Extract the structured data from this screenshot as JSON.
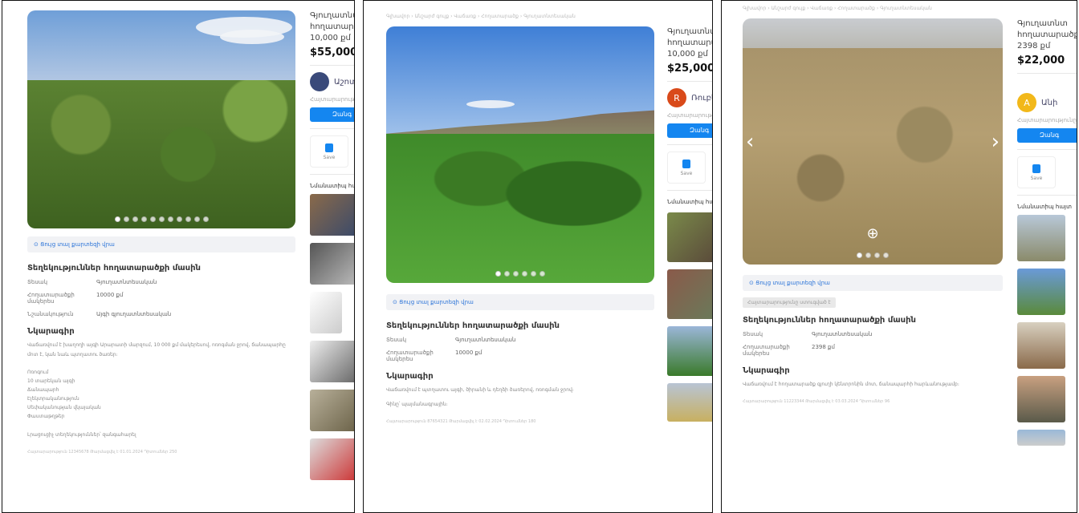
{
  "panels": [
    {
      "side": {
        "title_line1": "Գյուղատնտ",
        "title_line2": "հողատարածք",
        "title_line3": "10,000 քմ",
        "price": "$55,000",
        "seller_name": "Աշոտ",
        "posted": "Հայտարարությունը",
        "cta_label": "Զանգ",
        "save_label": "Save",
        "similar_heading": "Նմանատիպ հայտ"
      },
      "content": {
        "map_link": "Ցույց տալ քարտեզի վրա",
        "info_heading": "Տեղեկություններ հողատարածքի մասին",
        "rows": [
          {
            "k": "Տեսակ",
            "v": "Գյուղատնտեսական"
          },
          {
            "k": "Հողատարածքի մակերես",
            "v": "10000 քմ"
          },
          {
            "k": "Նշանակություն",
            "v": "Այգի գյուղատնտեսական"
          }
        ],
        "desc_heading": "Նկարագիր",
        "desc": "Վաճառվում է խաղողի այգի Արարատի մարզում, 10 000 քմ մակերեսով, ոռոգման ջրով, ճանապարհը մոտ է, կան նաև պտղատու ծառեր։",
        "list": [
          "Ոռոգում",
          "10 տարեկան այգի",
          "Ճանապարհ",
          "Էլեկտրականություն",
          "Սեփականության վկայական",
          "Փաստաթղթեր"
        ],
        "extra": "Լրացուցիչ տեղեկություններ՝ զանգահարել",
        "footer": "Հայտարարություն 12345678   Թարմացվել է 01.01.2024   Դիտումներ 250"
      }
    },
    {
      "crumb": "Գլխավոր › Անշարժ գույք › Վաճառք › Հողատարածք › Գյուղատնտեսական",
      "side": {
        "title_line1": "Գյուղատնտ",
        "title_line2": "հողատարածք",
        "title_line3": "10,000 քմ",
        "price": "$25,000",
        "seller_name": "Ռուբեն",
        "avatar_letter": "R",
        "posted": "Հայտարարությունը",
        "cta_label": "Զանգ",
        "save_label": "Save",
        "similar_heading": "Նմանատիպ հայտարարություններ"
      },
      "content": {
        "map_link": "Ցույց տալ քարտեզի վրա",
        "info_heading": "Տեղեկություններ հողատարածքի մասին",
        "rows": [
          {
            "k": "Տեսակ",
            "v": "Գյուղատնտեսական"
          },
          {
            "k": "Հողատարածքի մակերես",
            "v": "10000 քմ"
          }
        ],
        "desc_heading": "Նկարագիր",
        "desc": "Վաճառվում է պտղատու այգի, ծիրանի և դեղձի ծառերով, ոռոգման ջրով։",
        "desc2": "Գինը՝ պայմանագրային։",
        "footer": "Հայտարարություն 87654321   Թարմացվել է 02.02.2024   Դիտումներ 180"
      }
    },
    {
      "crumb": "Գլխավոր › Անշարժ գույք › Վաճառք › Հողատարածք › Գյուղատնտեսական",
      "side": {
        "title_line1": "Գյուղատնտ",
        "title_line2": "հողատարածք",
        "title_line3": "2398 քմ",
        "price": "$22,000",
        "seller_name": "Անի",
        "avatar_letter": "A",
        "posted": "Հայտարարությունը",
        "cta_label": "Զանգ",
        "save_label": "Save",
        "similar_heading": "Նմանատիպ հայտ"
      },
      "content": {
        "map_link": "Ցույց տալ քարտեզի վրա",
        "tag": "Հայտարարությունը ստուգված է",
        "info_heading": "Տեղեկություններ հողատարածքի մասին",
        "rows": [
          {
            "k": "Տեսակ",
            "v": "Գյուղատնտեսական"
          },
          {
            "k": "Հողատարածքի մակերես",
            "v": "2398 քմ"
          }
        ],
        "desc_heading": "Նկարագիր",
        "desc": "Վաճառվում է հողատարածք գյուղի կենտրոնին մոտ, ճանապարհի հարևանությամբ։",
        "footer": "Հայտարարություն 11223344   Թարմացվել է 03.03.2024   Դիտումներ 96"
      }
    }
  ],
  "icons": {
    "prev": "‹",
    "next": "›",
    "zoom": "⊕",
    "map": "⊙"
  }
}
